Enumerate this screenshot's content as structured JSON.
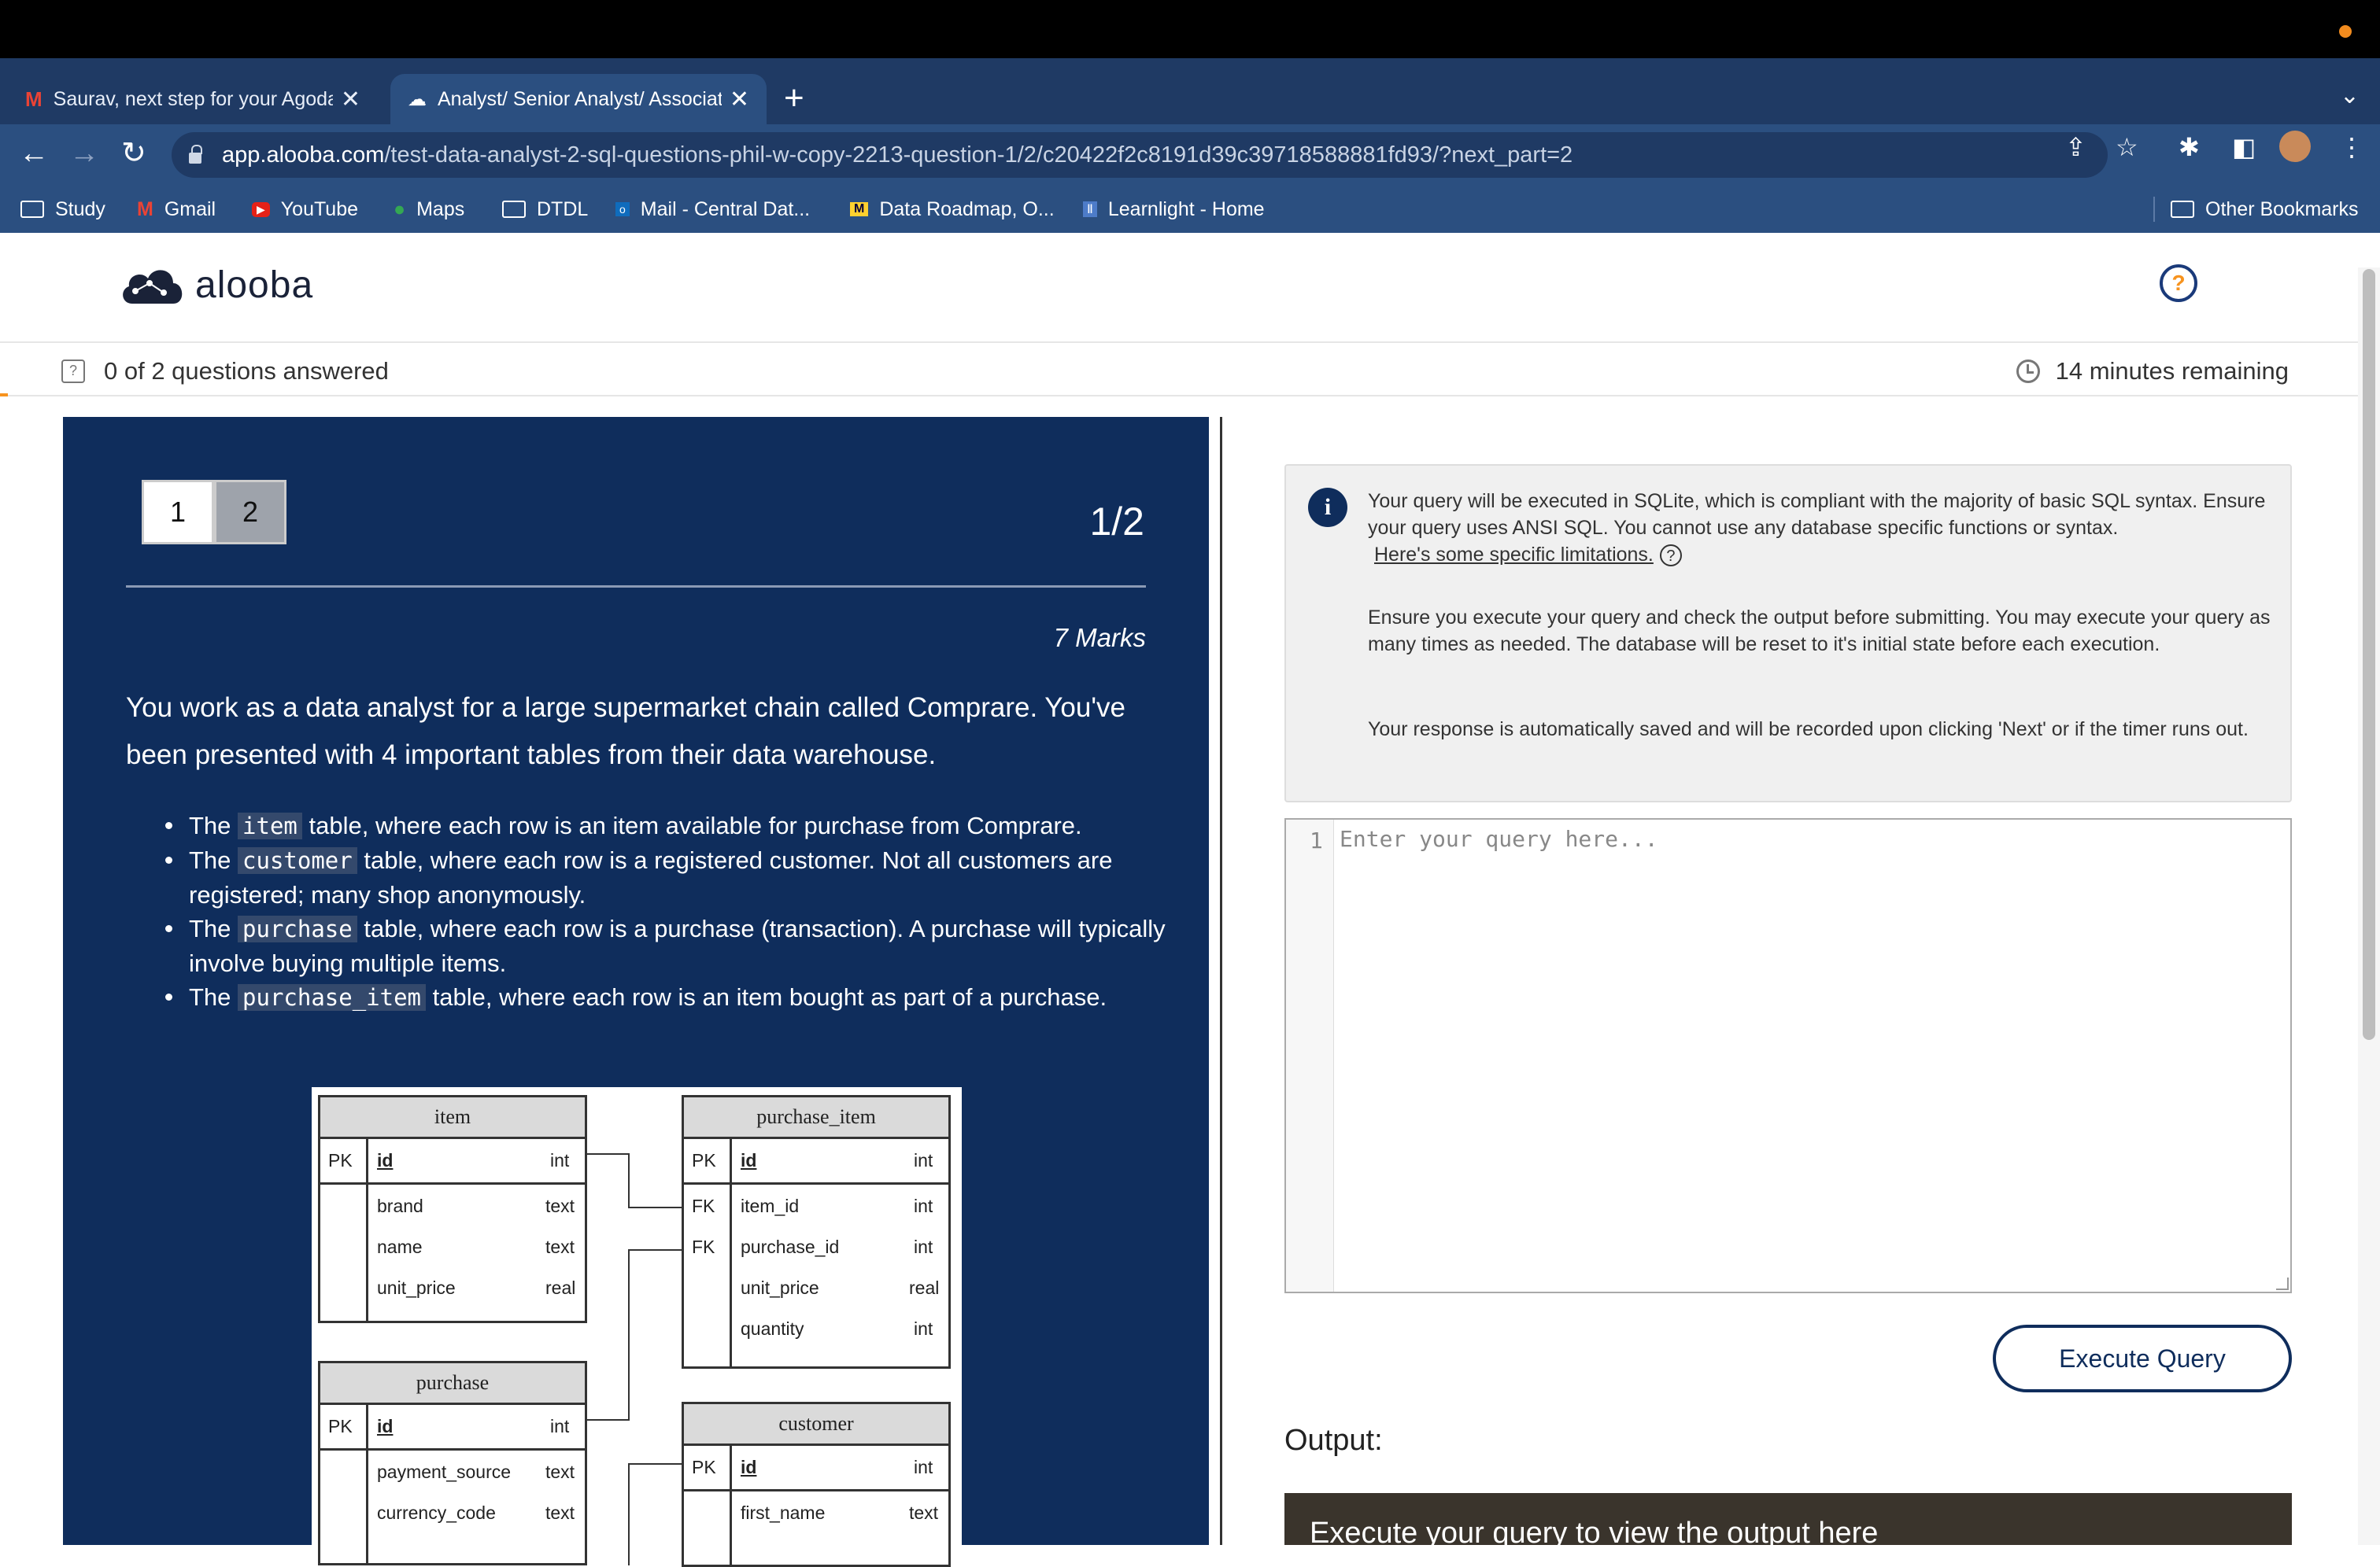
{
  "browser": {
    "tabs": [
      {
        "title": "Saurav, next step for your Agoda application",
        "close": "✕"
      },
      {
        "title": "Analyst/ Senior Analyst/ Associate",
        "close": "✕"
      }
    ],
    "new_tab": "+",
    "url_host": "app.alooba.com",
    "url_path": "/test-data-analyst-2-sql-questions-phil-w-copy-2213-question-1/2/c20422f2c8191d39c39718588881fd93/?next_part=2",
    "bookmarks": [
      "Study",
      "Gmail",
      "YouTube",
      "Maps",
      "DTDL",
      "Mail - Central Dat...",
      "Data Roadmap, O...",
      "Learnlight - Home"
    ],
    "other_bookmarks": "Other Bookmarks"
  },
  "app": {
    "logo_text": "alooba",
    "help_icon": "?",
    "questions_answered": "0 of 2 questions answered",
    "time_remaining": "14 minutes remaining"
  },
  "question": {
    "nav": [
      "1",
      "2"
    ],
    "number": "1/2",
    "marks": "7 Marks",
    "intro": "You work as a data analyst for a large supermarket chain called Comprare. You've been presented with 4 important tables from their data warehouse.",
    "bullets": [
      {
        "pre": "The",
        "code": "item",
        "post": "table, where each row is an item available for purchase from Comprare."
      },
      {
        "pre": "The",
        "code": "customer",
        "post": "table, where each row is a registered customer. Not all customers are registered; many shop anonymously."
      },
      {
        "pre": "The",
        "code": "purchase",
        "post": "table, where each row is a purchase (transaction). A purchase will typically involve buying multiple items."
      },
      {
        "pre": "The",
        "code": "purchase_item",
        "post": "table, where each row is an item bought as part of a purchase."
      }
    ]
  },
  "erd": {
    "item": {
      "name": "item",
      "pk": [
        "PK",
        "id",
        "int"
      ],
      "rows": [
        [
          "brand",
          "text"
        ],
        [
          "name",
          "text"
        ],
        [
          "unit_price",
          "real"
        ]
      ]
    },
    "purchase_item": {
      "name": "purchase_item",
      "pk": [
        "PK",
        "id",
        "int"
      ],
      "rows": [
        [
          "FK",
          "item_id",
          "int"
        ],
        [
          "FK",
          "purchase_id",
          "int"
        ],
        [
          "",
          "unit_price",
          "real"
        ],
        [
          "",
          "quantity",
          "int"
        ]
      ]
    },
    "purchase": {
      "name": "purchase",
      "pk": [
        "PK",
        "id",
        "int"
      ],
      "rows": [
        [
          "payment_source",
          "text"
        ],
        [
          "currency_code",
          "text"
        ]
      ]
    },
    "customer": {
      "name": "customer",
      "pk": [
        "PK",
        "id",
        "int"
      ],
      "rows": [
        [
          "first_name",
          "text"
        ]
      ]
    }
  },
  "info": {
    "p1": "Your query will be executed in SQLite, which is compliant with the majority of basic SQL syntax. Ensure your query uses ANSI SQL. You cannot use any database specific functions or syntax.",
    "limitations_link": "Here's some specific limitations.",
    "p2": "Ensure you execute your query and check the output before submitting. You may execute your query as many times as needed. The database will be reset to it's initial state before each execution.",
    "p3": "Your response is automatically saved and will be recorded upon clicking 'Next' or if the timer runs out."
  },
  "editor": {
    "line_number": "1",
    "placeholder": "Enter your query here...",
    "value": ""
  },
  "execute_label": "Execute Query",
  "output_label": "Output:",
  "output_placeholder": "Execute your query to view the output here",
  "colors": {
    "panel": "#0f2d5c",
    "accent": "#f7931e",
    "browser": "#2b4f80"
  }
}
